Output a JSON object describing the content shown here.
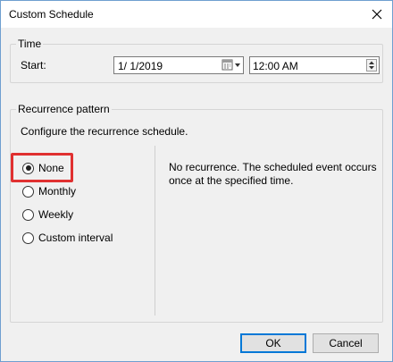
{
  "window": {
    "title": "Custom Schedule"
  },
  "time_group": {
    "legend": "Time",
    "start_label": "Start:",
    "date_value": "1/  1/2019",
    "time_value": "12:00 AM"
  },
  "recurrence_group": {
    "legend": "Recurrence pattern",
    "instruction": "Configure the recurrence schedule.",
    "options": [
      {
        "label": "None",
        "checked": true
      },
      {
        "label": "Monthly",
        "checked": false
      },
      {
        "label": "Weekly",
        "checked": false
      },
      {
        "label": "Custom interval",
        "checked": false
      }
    ],
    "description": "No recurrence. The scheduled event occurs once at the specified time."
  },
  "buttons": {
    "ok": "OK",
    "cancel": "Cancel"
  },
  "icons": {
    "close": "close-icon",
    "calendar": "calendar-dropdown-icon",
    "spin_up": "spin-up-icon",
    "spin_down": "spin-down-icon"
  },
  "colors": {
    "highlight": "#e03030",
    "default_button_border": "#0078d7"
  }
}
